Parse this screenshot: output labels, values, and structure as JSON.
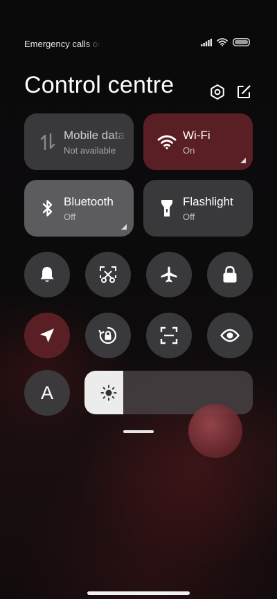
{
  "status_bar": {
    "text": "Emergency calls only",
    "icons": [
      "signal-icon",
      "wifi-icon",
      "battery-icon"
    ]
  },
  "header": {
    "title": "Control centre",
    "buttons": [
      "settings-icon",
      "edit-icon"
    ]
  },
  "tiles": {
    "mobile_data": {
      "label": "Mobile data",
      "state": "Not available",
      "icon": "mobile-data-icon"
    },
    "wifi": {
      "label": "Wi-Fi",
      "state": "On",
      "icon": "wifi-icon"
    },
    "bluetooth": {
      "label": "Bluetooth",
      "state": "Off",
      "icon": "bluetooth-icon"
    },
    "flashlight": {
      "label": "Flashlight",
      "state": "Off",
      "icon": "flashlight-icon"
    }
  },
  "toggles": [
    {
      "name": "bell-icon",
      "active": false
    },
    {
      "name": "screenshot-icon",
      "active": false
    },
    {
      "name": "airplane-icon",
      "active": false
    },
    {
      "name": "lock-icon",
      "active": false
    },
    {
      "name": "location-icon",
      "active": true
    },
    {
      "name": "rotation-lock-icon",
      "active": false
    },
    {
      "name": "scanner-icon",
      "active": false
    },
    {
      "name": "reading-mode-icon",
      "active": false
    }
  ],
  "auto_brightness": {
    "label": "A"
  },
  "brightness": {
    "level_percent": 23,
    "icon": "sun-icon"
  },
  "colors": {
    "accent_active": "#5a1f24",
    "tile_bg": "#3e3e40"
  }
}
